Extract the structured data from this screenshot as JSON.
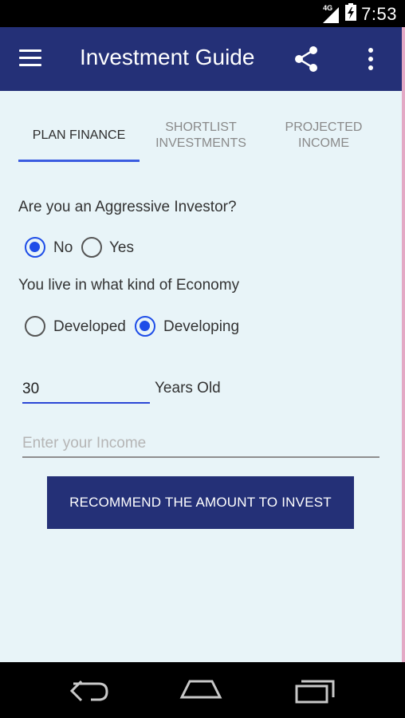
{
  "status_bar": {
    "network": "4G",
    "time": "7:53",
    "icons": [
      "signal-icon",
      "battery-icon"
    ]
  },
  "app_bar": {
    "title": "Investment Guide",
    "icons": [
      "menu-icon",
      "share-icon",
      "overflow-menu-icon"
    ]
  },
  "tabs": [
    {
      "label_line1": "PLAN FINANCE",
      "label_line2": "",
      "active": true
    },
    {
      "label_line1": "SHORTLIST",
      "label_line2": "INVESTMENTS",
      "active": false
    },
    {
      "label_line1": "PROJECTED",
      "label_line2": "INCOME",
      "active": false
    }
  ],
  "form": {
    "investor_question": "Are you an Aggressive Investor?",
    "investor_options": [
      {
        "label": "No",
        "selected": true
      },
      {
        "label": "Yes",
        "selected": false
      }
    ],
    "economy_question": "You live in what kind of Economy",
    "economy_options": [
      {
        "label": "Developed",
        "selected": false
      },
      {
        "label": "Developing",
        "selected": true
      }
    ],
    "age_value": "30",
    "age_suffix": "Years Old",
    "income_placeholder": "Enter your Income",
    "recommend_button": "RECOMMEND THE AMOUNT TO INVEST"
  },
  "nav_bar": {
    "icons": [
      "back-icon",
      "home-icon",
      "recents-icon"
    ]
  },
  "colors": {
    "primary": "#243077",
    "accent": "#1e4de8",
    "background": "#e8f4f8"
  }
}
